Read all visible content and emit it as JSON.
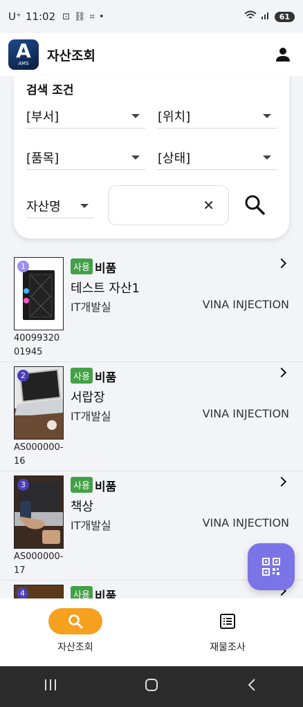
{
  "status_bar": {
    "carrier": "U⁺",
    "time": "11:02",
    "icons": [
      "screen-record-icon",
      "link-icon",
      "screenshot-icon",
      "dot-icon"
    ],
    "battery": "61"
  },
  "header": {
    "logo_letter": "A",
    "logo_sub": "AMS",
    "title": "자산조회"
  },
  "search": {
    "title": "검색 조건",
    "department": "[부서]",
    "location": "[위치]",
    "category": "[품목]",
    "status": "[상태]",
    "field_select": "자산명",
    "input_value": "",
    "clear": "✕"
  },
  "assets": [
    {
      "index": "1",
      "badge": "사용",
      "type": "비품",
      "name": "테스트 자산1",
      "dept": "IT개발실",
      "location": "VINA INJECTION",
      "code_line1": "40099320",
      "code_line2": "01945",
      "num_color": "#9b8df0"
    },
    {
      "index": "2",
      "badge": "사용",
      "type": "비품",
      "name": "서랍장",
      "dept": "IT개발실",
      "location": "VINA INJECTION",
      "code_line1": "AS000000-",
      "code_line2": "16",
      "num_color": "#4a3fb5"
    },
    {
      "index": "3",
      "badge": "사용",
      "type": "비품",
      "name": "책상",
      "dept": "IT개발실",
      "location": "VINA INJECTION",
      "code_line1": "AS000000-",
      "code_line2": "17",
      "num_color": "#4a3fb5"
    },
    {
      "index": "4",
      "badge": "사용",
      "type": "비품",
      "name": "",
      "dept": "",
      "location": "",
      "code_line1": "",
      "code_line2": "",
      "num_color": "#4a3fb5"
    }
  ],
  "bottom_nav": {
    "asset_search": "자산조회",
    "inventory": "재물조사"
  },
  "colors": {
    "accent": "#f5a01f",
    "fab": "#7b74e6",
    "badge": "#43a047"
  }
}
